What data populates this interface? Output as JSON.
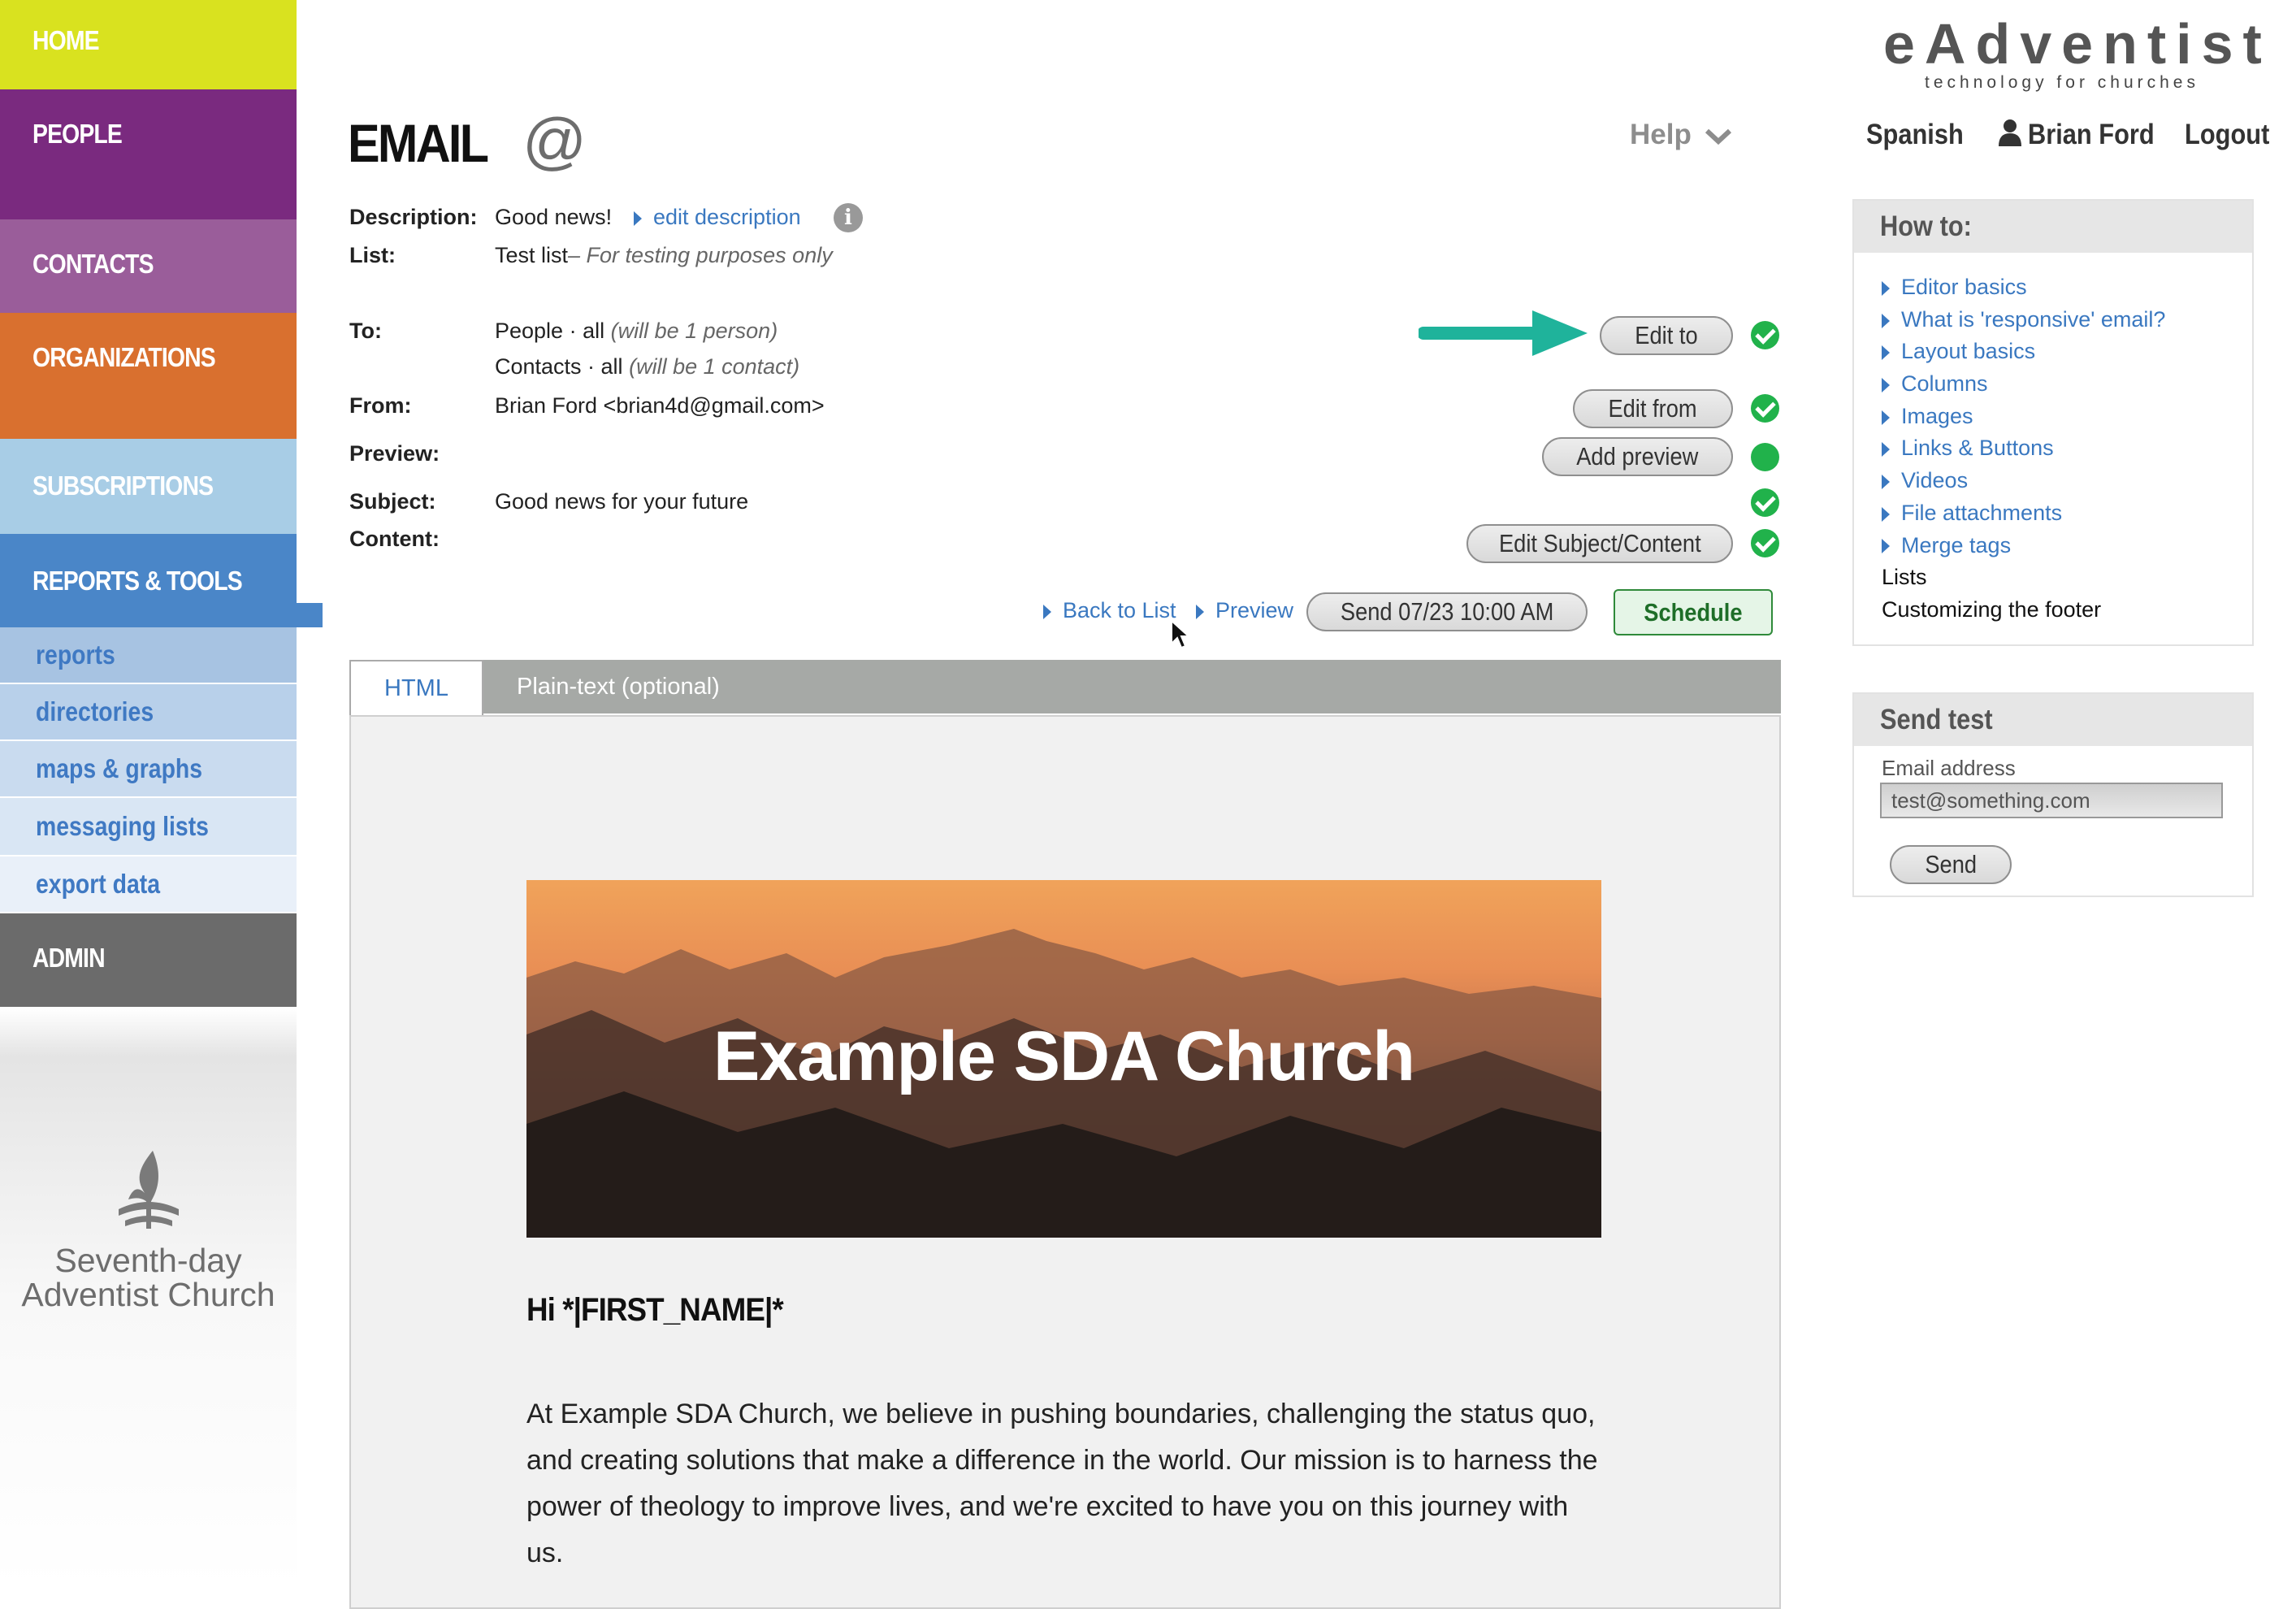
{
  "nav": {
    "home": "HOME",
    "people": "PEOPLE",
    "contacts": "CONTACTS",
    "organizations": "ORGANIZATIONS",
    "subscriptions": "SUBSCRIPTIONS",
    "reports_tools": "REPORTS & TOOLS",
    "sub_items": [
      "reports",
      "directories",
      "maps & graphs",
      "messaging lists",
      "export data"
    ],
    "admin": "ADMIN",
    "colors": {
      "home": "#d9e21f",
      "people": "#7a2a7f",
      "contacts": "#9a5d9a",
      "organizations": "#d9702f",
      "subscriptions": "#a8cde6",
      "reports_tools": "#4a86c8",
      "admin": "#6b6b6b"
    }
  },
  "church_logo": {
    "line1": "Seventh-day",
    "line2": "Adventist Church"
  },
  "header": {
    "title": "EMAIL",
    "at_symbol": "@",
    "help": "Help",
    "brand_name": "eAdventist",
    "brand_tagline": "technology for churches",
    "language": "Spanish",
    "user": "Brian Ford",
    "logout": "Logout"
  },
  "email": {
    "description_label": "Description:",
    "description_value": "Good news!",
    "edit_description": "edit description",
    "list_label": "List:",
    "list_value": "Test list",
    "list_note": "– For testing purposes only",
    "to_label": "To:",
    "to_people": "People · all",
    "to_people_note": "(will be 1 person)",
    "to_contacts": "Contacts · all",
    "to_contacts_note": "(will be 1 contact)",
    "from_label": "From:",
    "from_value": "Brian Ford <brian4d@gmail.com>",
    "preview_label": "Preview:",
    "subject_label": "Subject:",
    "subject_value": "Good news for your future",
    "content_label": "Content:"
  },
  "buttons": {
    "edit_to": "Edit to",
    "edit_from": "Edit from",
    "add_preview": "Add preview",
    "edit_subject_content": "Edit Subject/Content",
    "back_to_list": "Back to List",
    "preview": "Preview",
    "send_time": "Send 07/23 10:00 AM",
    "schedule": "Schedule"
  },
  "editor": {
    "tab_html": "HTML",
    "tab_plain": "Plain-text (optional)",
    "hero_title": "Example SDA Church",
    "greeting": "Hi *|FIRST_NAME|*",
    "body": "At Example SDA Church, we believe in pushing boundaries, challenging the status quo, and creating solutions that make a difference in the world. Our mission is to harness the power of theology to improve lives, and we're excited to have you on this journey with us."
  },
  "howto": {
    "title": "How to:",
    "links": [
      "Editor basics",
      "What is 'responsive' email?",
      "Layout basics",
      "Columns",
      "Images",
      "Links & Buttons",
      "Videos",
      "File attachments",
      "Merge tags"
    ],
    "plain_items": [
      "Lists",
      "Customizing the footer"
    ]
  },
  "send_test": {
    "title": "Send test",
    "email_label": "Email address",
    "email_value": "test@something.com",
    "send": "Send"
  }
}
